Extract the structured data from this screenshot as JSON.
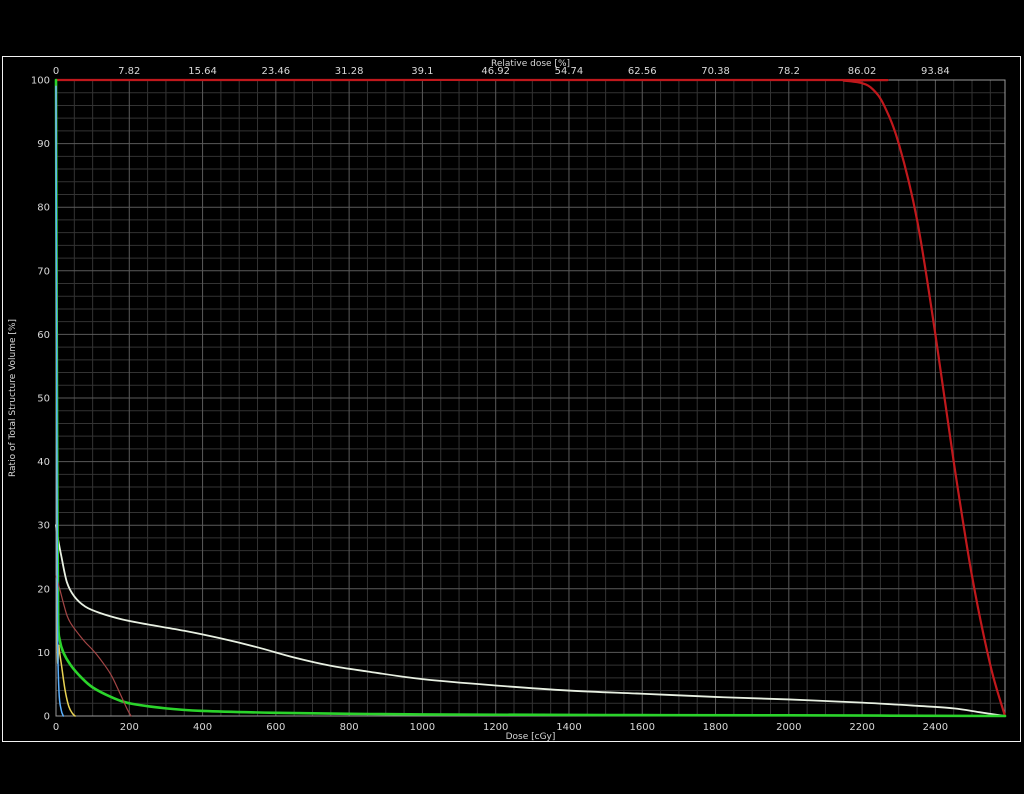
{
  "chart_data": {
    "type": "line",
    "xlabel": "Dose [cGy]",
    "x2label": "Relative dose [%]",
    "ylabel": "Ratio of Total Structure Volume [%]",
    "xlim": [
      0,
      2590
    ],
    "ylim": [
      0,
      100
    ],
    "xticks": [
      0,
      200,
      400,
      600,
      800,
      1000,
      1200,
      1400,
      1600,
      1800,
      2000,
      2200,
      2400
    ],
    "yticks": [
      0,
      10,
      20,
      30,
      40,
      50,
      60,
      70,
      80,
      90,
      100
    ],
    "x2ticks": [
      "0",
      "7.82",
      "15.64",
      "23.46",
      "31.28",
      "39.1",
      "46.92",
      "54.74",
      "62.56",
      "70.38",
      "78.2",
      "86.02",
      "93.84"
    ],
    "grid": true,
    "background": "#000000",
    "grid_color": "#4a4a4a",
    "series": [
      {
        "color": "#c0181c",
        "width": 2.2,
        "x": [
          0,
          2100,
          2150,
          2200,
          2230,
          2260,
          2300,
          2350,
          2400,
          2450,
          2500,
          2550,
          2590
        ],
        "y": [
          100,
          100,
          99.9,
          99.5,
          98.5,
          96,
          90,
          78,
          60,
          40,
          22,
          8,
          0
        ]
      },
      {
        "color": "#e8f0e2",
        "width": 1.8,
        "x": [
          0,
          5,
          15,
          30,
          50,
          80,
          120,
          180,
          250,
          350,
          450,
          550,
          650,
          750,
          850,
          1000,
          1200,
          1400,
          1600,
          1800,
          2000,
          2200,
          2350,
          2450,
          2520,
          2590
        ],
        "y": [
          30,
          28,
          25,
          21,
          18.8,
          17.2,
          16.2,
          15.2,
          14.4,
          13.4,
          12.2,
          10.8,
          9.2,
          7.9,
          7,
          5.8,
          4.8,
          4,
          3.5,
          3,
          2.6,
          2.1,
          1.6,
          1.2,
          0.6,
          0
        ]
      },
      {
        "color": "#2bd32b",
        "width": 2.6,
        "x": [
          0,
          2,
          4,
          6,
          10,
          20,
          40,
          70,
          100,
          150,
          200,
          300,
          400,
          600,
          800,
          1000,
          1500,
          2000,
          2590
        ],
        "y": [
          100,
          60,
          30,
          15,
          12,
          10,
          8,
          6,
          4.5,
          3,
          2,
          1.2,
          0.8,
          0.5,
          0.35,
          0.25,
          0.15,
          0.1,
          0
        ]
      },
      {
        "color": "#a34545",
        "width": 1.2,
        "x": [
          0,
          10,
          20,
          30,
          40,
          60,
          80,
          100,
          120,
          150,
          175,
          195,
          205
        ],
        "y": [
          22,
          20,
          17.8,
          15.8,
          14.6,
          13,
          11.6,
          10.4,
          9,
          6.5,
          3.5,
          1,
          0
        ]
      },
      {
        "color": "#e8d252",
        "width": 1.5,
        "x": [
          0,
          3,
          8,
          15,
          25,
          35,
          45,
          52
        ],
        "y": [
          99,
          16,
          11,
          8,
          4,
          1.5,
          0.4,
          0
        ]
      },
      {
        "color": "#5ab0ff",
        "width": 1.5,
        "x": [
          0,
          2,
          4,
          8,
          14,
          20
        ],
        "y": [
          99,
          50,
          15,
          4,
          1,
          0
        ]
      }
    ]
  }
}
